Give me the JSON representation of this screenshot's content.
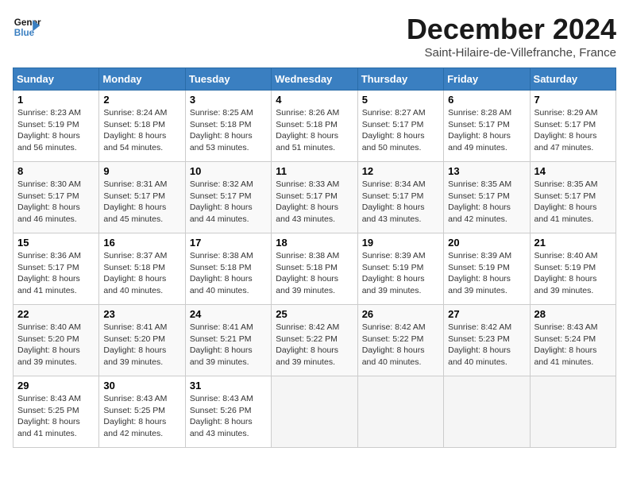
{
  "header": {
    "logo_line1": "General",
    "logo_line2": "Blue",
    "month_title": "December 2024",
    "location": "Saint-Hilaire-de-Villefranche, France"
  },
  "weekdays": [
    "Sunday",
    "Monday",
    "Tuesday",
    "Wednesday",
    "Thursday",
    "Friday",
    "Saturday"
  ],
  "weeks": [
    [
      {
        "day": "1",
        "sunrise": "8:23 AM",
        "sunset": "5:19 PM",
        "daylight": "8 hours and 56 minutes."
      },
      {
        "day": "2",
        "sunrise": "8:24 AM",
        "sunset": "5:18 PM",
        "daylight": "8 hours and 54 minutes."
      },
      {
        "day": "3",
        "sunrise": "8:25 AM",
        "sunset": "5:18 PM",
        "daylight": "8 hours and 53 minutes."
      },
      {
        "day": "4",
        "sunrise": "8:26 AM",
        "sunset": "5:18 PM",
        "daylight": "8 hours and 51 minutes."
      },
      {
        "day": "5",
        "sunrise": "8:27 AM",
        "sunset": "5:17 PM",
        "daylight": "8 hours and 50 minutes."
      },
      {
        "day": "6",
        "sunrise": "8:28 AM",
        "sunset": "5:17 PM",
        "daylight": "8 hours and 49 minutes."
      },
      {
        "day": "7",
        "sunrise": "8:29 AM",
        "sunset": "5:17 PM",
        "daylight": "8 hours and 47 minutes."
      }
    ],
    [
      {
        "day": "8",
        "sunrise": "8:30 AM",
        "sunset": "5:17 PM",
        "daylight": "8 hours and 46 minutes."
      },
      {
        "day": "9",
        "sunrise": "8:31 AM",
        "sunset": "5:17 PM",
        "daylight": "8 hours and 45 minutes."
      },
      {
        "day": "10",
        "sunrise": "8:32 AM",
        "sunset": "5:17 PM",
        "daylight": "8 hours and 44 minutes."
      },
      {
        "day": "11",
        "sunrise": "8:33 AM",
        "sunset": "5:17 PM",
        "daylight": "8 hours and 43 minutes."
      },
      {
        "day": "12",
        "sunrise": "8:34 AM",
        "sunset": "5:17 PM",
        "daylight": "8 hours and 43 minutes."
      },
      {
        "day": "13",
        "sunrise": "8:35 AM",
        "sunset": "5:17 PM",
        "daylight": "8 hours and 42 minutes."
      },
      {
        "day": "14",
        "sunrise": "8:35 AM",
        "sunset": "5:17 PM",
        "daylight": "8 hours and 41 minutes."
      }
    ],
    [
      {
        "day": "15",
        "sunrise": "8:36 AM",
        "sunset": "5:17 PM",
        "daylight": "8 hours and 41 minutes."
      },
      {
        "day": "16",
        "sunrise": "8:37 AM",
        "sunset": "5:18 PM",
        "daylight": "8 hours and 40 minutes."
      },
      {
        "day": "17",
        "sunrise": "8:38 AM",
        "sunset": "5:18 PM",
        "daylight": "8 hours and 40 minutes."
      },
      {
        "day": "18",
        "sunrise": "8:38 AM",
        "sunset": "5:18 PM",
        "daylight": "8 hours and 39 minutes."
      },
      {
        "day": "19",
        "sunrise": "8:39 AM",
        "sunset": "5:19 PM",
        "daylight": "8 hours and 39 minutes."
      },
      {
        "day": "20",
        "sunrise": "8:39 AM",
        "sunset": "5:19 PM",
        "daylight": "8 hours and 39 minutes."
      },
      {
        "day": "21",
        "sunrise": "8:40 AM",
        "sunset": "5:19 PM",
        "daylight": "8 hours and 39 minutes."
      }
    ],
    [
      {
        "day": "22",
        "sunrise": "8:40 AM",
        "sunset": "5:20 PM",
        "daylight": "8 hours and 39 minutes."
      },
      {
        "day": "23",
        "sunrise": "8:41 AM",
        "sunset": "5:20 PM",
        "daylight": "8 hours and 39 minutes."
      },
      {
        "day": "24",
        "sunrise": "8:41 AM",
        "sunset": "5:21 PM",
        "daylight": "8 hours and 39 minutes."
      },
      {
        "day": "25",
        "sunrise": "8:42 AM",
        "sunset": "5:22 PM",
        "daylight": "8 hours and 39 minutes."
      },
      {
        "day": "26",
        "sunrise": "8:42 AM",
        "sunset": "5:22 PM",
        "daylight": "8 hours and 40 minutes."
      },
      {
        "day": "27",
        "sunrise": "8:42 AM",
        "sunset": "5:23 PM",
        "daylight": "8 hours and 40 minutes."
      },
      {
        "day": "28",
        "sunrise": "8:43 AM",
        "sunset": "5:24 PM",
        "daylight": "8 hours and 41 minutes."
      }
    ],
    [
      {
        "day": "29",
        "sunrise": "8:43 AM",
        "sunset": "5:25 PM",
        "daylight": "8 hours and 41 minutes."
      },
      {
        "day": "30",
        "sunrise": "8:43 AM",
        "sunset": "5:25 PM",
        "daylight": "8 hours and 42 minutes."
      },
      {
        "day": "31",
        "sunrise": "8:43 AM",
        "sunset": "5:26 PM",
        "daylight": "8 hours and 43 minutes."
      },
      null,
      null,
      null,
      null
    ]
  ]
}
